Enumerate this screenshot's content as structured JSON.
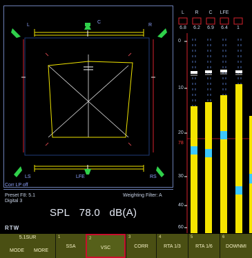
{
  "scope": {
    "channels": {
      "l": "L",
      "c": "C",
      "r": "R",
      "ls": "LS",
      "lfe": "LFE",
      "rs": "RS"
    },
    "corr_label": "Corr LP off"
  },
  "info": {
    "preset_line1": "Preset F8: 5.1",
    "preset_line2": "Digital 3",
    "weighting": "Weighting Filter: A",
    "spl_label": "SPL",
    "spl_value": "78.0",
    "spl_unit": "dB(A)",
    "logo": "RTW"
  },
  "meter": {
    "channels": [
      {
        "name": "L",
        "value": "6.8"
      },
      {
        "name": "R",
        "value": "6.2"
      },
      {
        "name": "C",
        "value": "6.9"
      },
      {
        "name": "LFE",
        "value": "6.4"
      },
      {
        "name": "",
        "value": "1"
      }
    ],
    "scale": [
      "0",
      "10",
      "20",
      "78",
      "30",
      "40",
      "60"
    ],
    "colors": {
      "bar": "#f5e400",
      "peak": "#3cc8ff",
      "ref": "#ff3b3b"
    }
  },
  "softkeys": {
    "mode_title": "5.1SUR",
    "mode": "MODE",
    "more": "MORE",
    "keys": [
      {
        "num": "1",
        "label": "SSA"
      },
      {
        "num": "2",
        "label": "VSC"
      },
      {
        "num": "3",
        "label": "CORR"
      },
      {
        "num": "4",
        "label": "RTA 1/3"
      },
      {
        "num": "5",
        "label": "RTA 1/6"
      },
      {
        "num": "6",
        "label": "DOWNMI"
      }
    ]
  }
}
